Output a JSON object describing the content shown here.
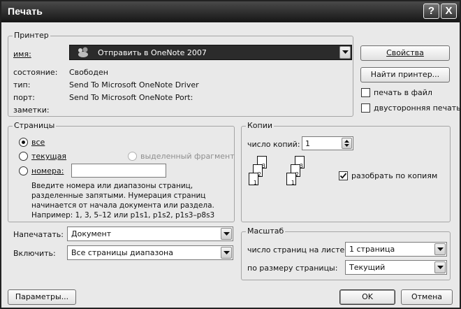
{
  "window": {
    "title": "Печать",
    "help_glyph": "?",
    "close_glyph": "X"
  },
  "printer": {
    "group_label": "Принтер",
    "name_label": "имя:",
    "name_value": "Отправить в OneNote 2007",
    "status_label": "состояние:",
    "status_value": "Свободен",
    "type_label": "тип:",
    "type_value": "Send To Microsoft OneNote Driver",
    "port_label": "порт:",
    "port_value": "Send To Microsoft OneNote Port:",
    "notes_label": "заметки:",
    "properties_button": "Свойства",
    "find_printer_button": "Найти принтер...",
    "print_to_file_label": "печать в файл",
    "duplex_label": "двусторонняя печать",
    "print_to_file_checked": false,
    "duplex_checked": false
  },
  "pages": {
    "group_label": "Страницы",
    "all_label": "все",
    "current_label": "текущая",
    "selection_label": "выделенный фрагмент",
    "numbers_label": "номера:",
    "numbers_value": "",
    "selected": "all",
    "hint_lines": [
      "Введите номера или диапазоны страниц,",
      "разделенные запятыми. Нумерация страниц",
      "начинается от начала документа или раздела.",
      "Например: 1, 3, 5–12 или p1s1, p1s2, p1s3–p8s3"
    ]
  },
  "copies": {
    "group_label": "Копии",
    "count_label": "число копий:",
    "count_value": "1",
    "collate_label": "разобрать по копиям",
    "collate_checked": true,
    "stack_numbers": [
      "1",
      "2",
      "3"
    ]
  },
  "print_what": {
    "label": "Напечатать:",
    "value": "Документ"
  },
  "include": {
    "label": "Включить:",
    "value": "Все страницы диапазона"
  },
  "zoom": {
    "group_label": "Масштаб",
    "pages_per_sheet_label": "число страниц на листе:",
    "pages_per_sheet_value": "1 страница",
    "scale_to_paper_label": "по размеру страницы:",
    "scale_to_paper_value": "Текущий"
  },
  "footer": {
    "options_button": "Параметры...",
    "ok_button": "OK",
    "cancel_button": "Отмена"
  }
}
